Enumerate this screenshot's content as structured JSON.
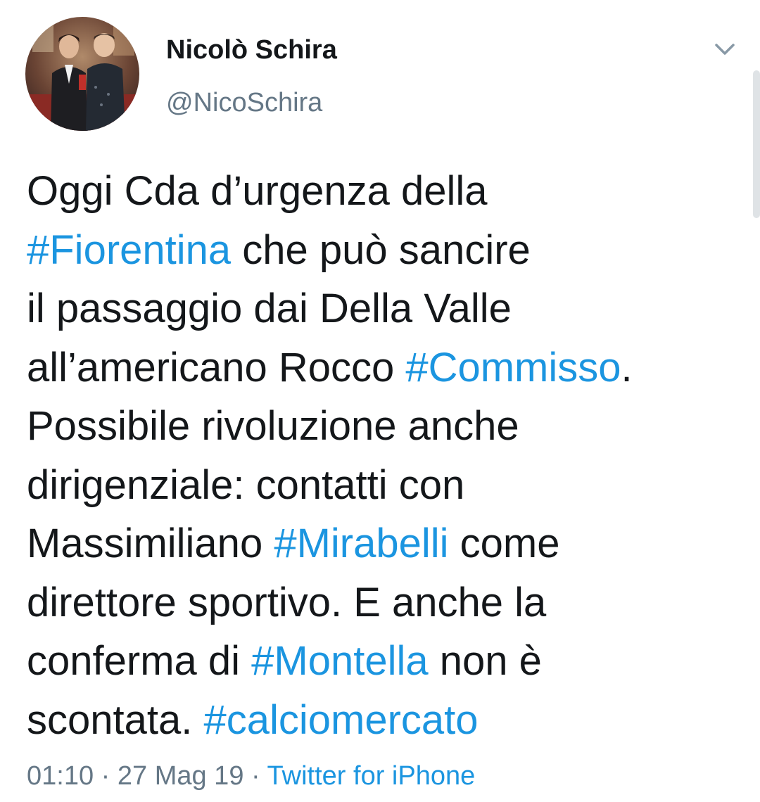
{
  "user": {
    "display_name": "Nicolò Schira",
    "handle": "@NicoSchira"
  },
  "tweet": {
    "lines": [
      [
        {
          "t": "Oggi Cda d’urgenza della"
        }
      ],
      [
        {
          "t": "#Fiorentina",
          "h": true
        },
        {
          "t": " che può sancire"
        }
      ],
      [
        {
          "t": "il passaggio dai Della Valle"
        }
      ],
      [
        {
          "t": "all’americano Rocco "
        },
        {
          "t": "#Commisso",
          "h": true
        },
        {
          "t": "."
        }
      ],
      [
        {
          "t": "Possibile rivoluzione anche"
        }
      ],
      [
        {
          "t": "dirigenziale: contatti con"
        }
      ],
      [
        {
          "t": "Massimiliano "
        },
        {
          "t": "#Mirabelli",
          "h": true
        },
        {
          "t": " come"
        }
      ],
      [
        {
          "t": "direttore sportivo. E anche la"
        }
      ],
      [
        {
          "t": "conferma di "
        },
        {
          "t": "#Montella",
          "h": true
        },
        {
          "t": " non è"
        }
      ],
      [
        {
          "t": "scontata. "
        },
        {
          "t": "#calciomercato",
          "h": true
        }
      ]
    ]
  },
  "meta": {
    "time": "01:10",
    "separator": " · ",
    "date": "27 Mag 19",
    "source": "Twitter for iPhone"
  },
  "icons": {
    "menu": "chevron-down-icon"
  },
  "colors": {
    "hashtag": "#1b95e0",
    "secondary_text": "#657786",
    "primary_text": "#14171a"
  }
}
